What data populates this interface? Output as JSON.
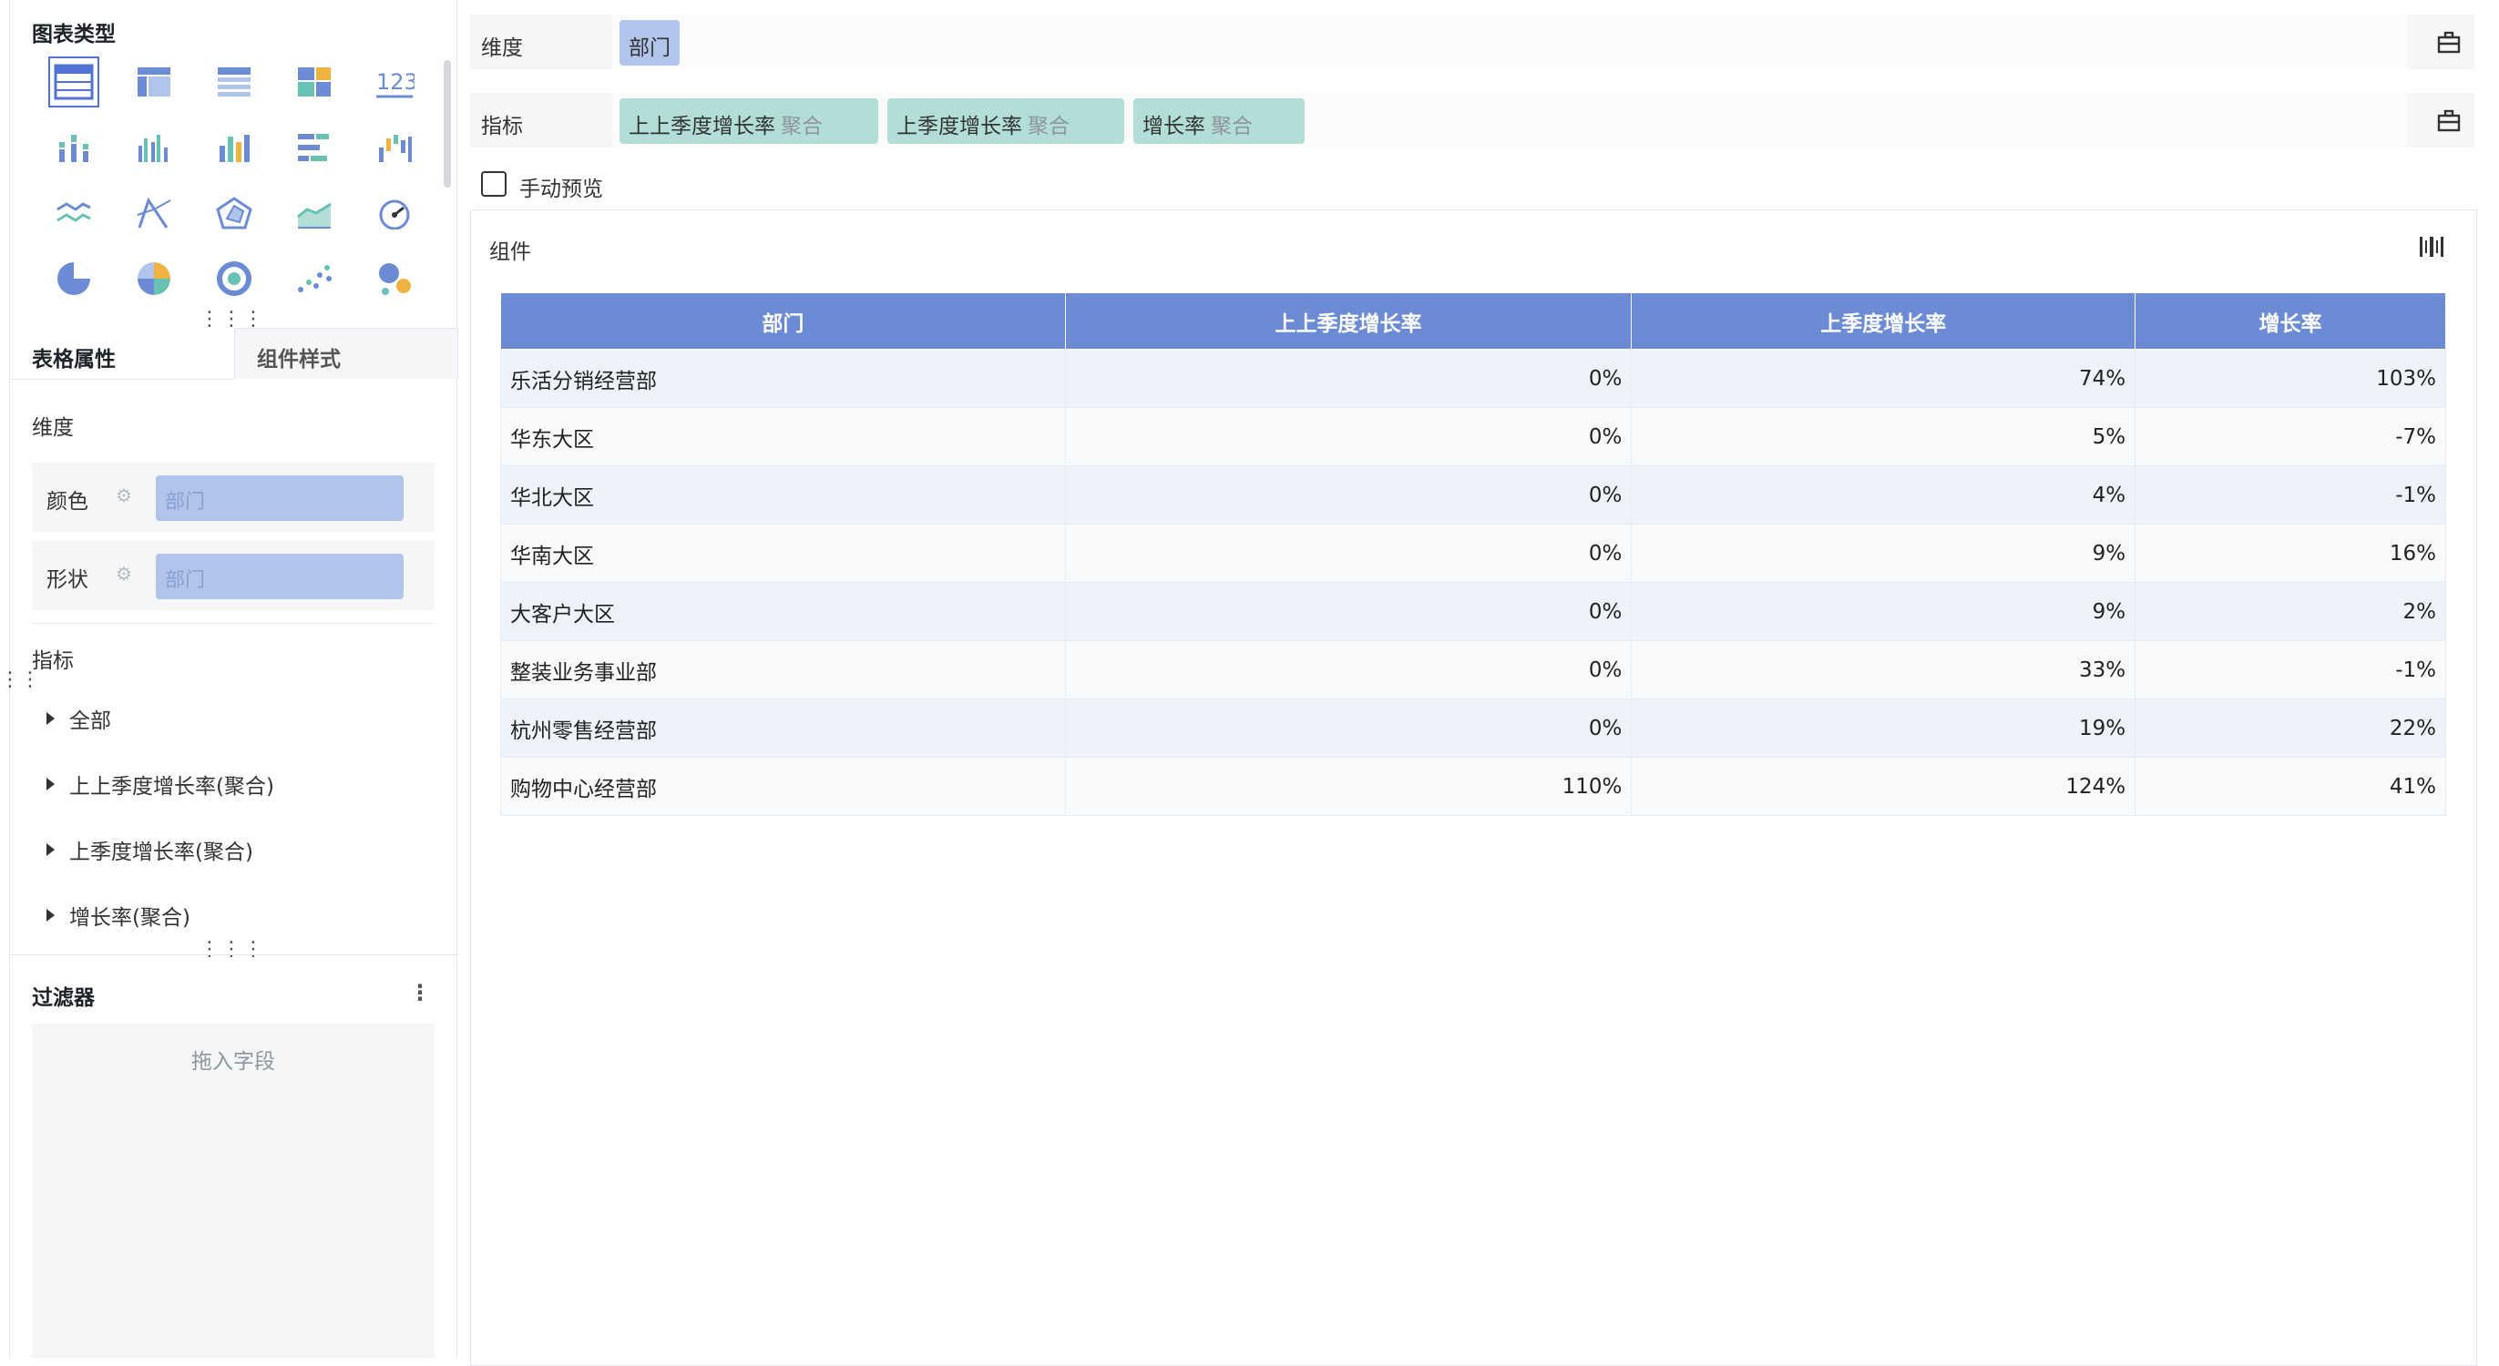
{
  "left_panel": {
    "chart_type_title": "图表类型",
    "chart_types": [
      {
        "icon": "table-icon",
        "selected": true
      },
      {
        "icon": "pivot-table-icon"
      },
      {
        "icon": "detail-table-icon"
      },
      {
        "icon": "dashboard-icon"
      },
      {
        "icon": "kpi-number-icon",
        "text": "123"
      },
      {
        "icon": "stacked-column-icon"
      },
      {
        "icon": "grouped-column-icon"
      },
      {
        "icon": "column-chart-icon"
      },
      {
        "icon": "bar-chart-icon"
      },
      {
        "icon": "waterfall-icon"
      },
      {
        "icon": "line-chart-icon"
      },
      {
        "icon": "scatter-line-icon"
      },
      {
        "icon": "radar-icon"
      },
      {
        "icon": "area-chart-icon"
      },
      {
        "icon": "gauge-icon"
      },
      {
        "icon": "pie-chart-icon"
      },
      {
        "icon": "rose-chart-icon"
      },
      {
        "icon": "donut-chart-icon"
      },
      {
        "icon": "scatter-icon"
      },
      {
        "icon": "bubble-icon"
      }
    ],
    "tabs": {
      "active": "表格属性",
      "inactive": "组件样式"
    },
    "dimension_label": "维度",
    "color_label": "颜色",
    "color_field": "部门",
    "shape_label": "形状",
    "shape_field": "部门",
    "metric_label": "指标",
    "metric_tree": [
      "全部",
      "上上季度增长率(聚合)",
      "上季度增长率(聚合)",
      "增长率(聚合)"
    ],
    "filter_title": "过滤器",
    "filter_placeholder": "拖入字段"
  },
  "shelves": {
    "dimension": {
      "label": "维度",
      "chips": [
        "部门"
      ]
    },
    "metric": {
      "label": "指标",
      "chips": [
        {
          "name": "上上季度增长率",
          "agg": "聚合"
        },
        {
          "name": "上季度增长率",
          "agg": "聚合"
        },
        {
          "name": "增长率",
          "agg": "聚合"
        }
      ]
    }
  },
  "manual_preview": {
    "label": "手动预览",
    "checked": false
  },
  "widget": {
    "title": "组件",
    "table": {
      "headers": [
        "部门",
        "上上季度增长率",
        "上季度增长率",
        "增长率"
      ],
      "rows": [
        [
          "乐活分销经营部",
          "0%",
          "74%",
          "103%"
        ],
        [
          "华东大区",
          "0%",
          "5%",
          "-7%"
        ],
        [
          "华北大区",
          "0%",
          "4%",
          "-1%"
        ],
        [
          "华南大区",
          "0%",
          "9%",
          "16%"
        ],
        [
          "大客户大区",
          "0%",
          "9%",
          "2%"
        ],
        [
          "整装业务事业部",
          "0%",
          "33%",
          "-1%"
        ],
        [
          "杭州零售经营部",
          "0%",
          "19%",
          "22%"
        ],
        [
          "购物中心经营部",
          "110%",
          "124%",
          "41%"
        ]
      ]
    }
  },
  "colors": {
    "accent": "#5173d8",
    "header": "#6b8cd5",
    "dim_chip": "#b1c4ec",
    "metric_chip": "#b3ded8"
  }
}
